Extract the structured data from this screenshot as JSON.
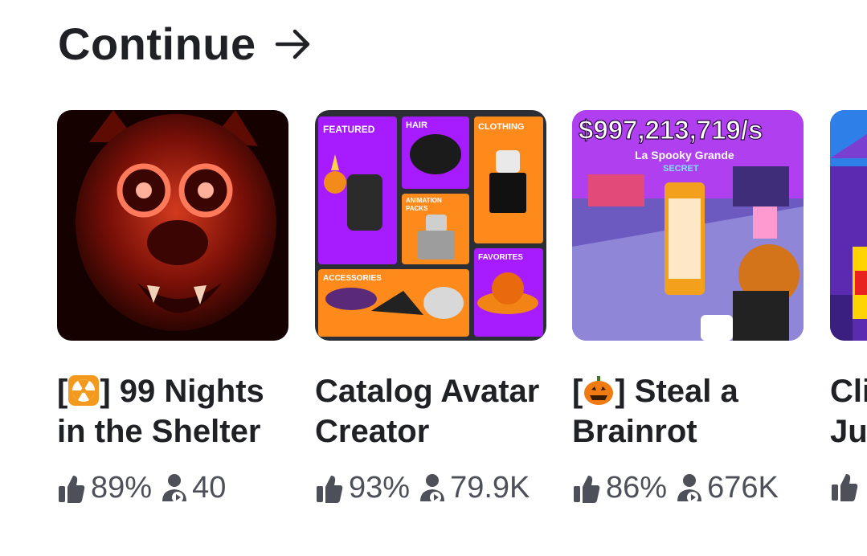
{
  "section": {
    "title": "Continue",
    "arrow_icon": "arrow-right-icon"
  },
  "games": [
    {
      "title_prefix": "[",
      "title_icon": "radiation-icon",
      "title_line1_rest": "] 99 Nights",
      "title_line2": "in the Shelter",
      "rating": "89%",
      "players": "40",
      "thumbnail": "red-wolf-creature-thumbnail"
    },
    {
      "title_line1": "Catalog Avatar",
      "title_line2": "Creator",
      "rating": "93%",
      "players": "79.9K",
      "thumbnail": "catalog-categories-thumbnail",
      "thumb_labels": {
        "featured": "FEATURED",
        "hair": "HAIR",
        "clothing": "CLOTHING",
        "animation": "ANIMATION",
        "packs": "PACKS",
        "favorites": "FAVORITES",
        "accessories": "ACCESSORIES"
      }
    },
    {
      "title_prefix": "[",
      "title_icon": "pumpkin-icon",
      "title_line1_rest": "] Steal a",
      "title_line2": "Brainrot",
      "rating": "86%",
      "players": "676K",
      "thumbnail": "brainrot-thumbnail",
      "thumb_labels": {
        "money": "$997,213,719/s",
        "name": "La Spooky Grande",
        "tag": "SECRET"
      }
    },
    {
      "title_line1": "Cli",
      "title_line2": "Ju",
      "thumbnail": "partial-castle-thumbnail"
    }
  ],
  "colors": {
    "text": "#1f2125",
    "stat_text": "#4d5058",
    "catalog_purple": "#a61bff",
    "catalog_orange": "#ff8a1c",
    "brainrot_purple": "#8a3bd8"
  }
}
